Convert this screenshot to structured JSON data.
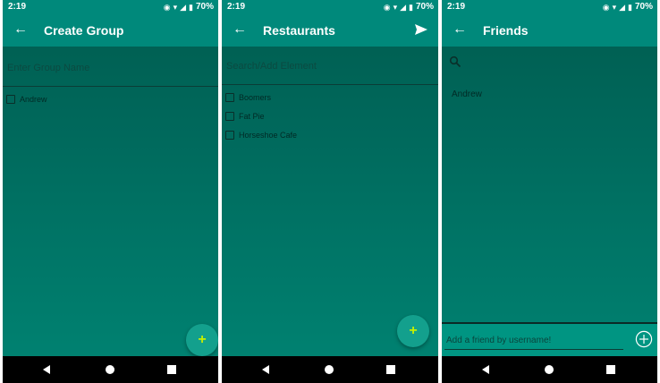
{
  "status_bar": {
    "time": "2:19",
    "battery": "70%"
  },
  "screens": [
    {
      "title": "Create Group",
      "input_placeholder": "Enter Group Name",
      "items": [
        {
          "label": "Andrew"
        }
      ],
      "fab_symbol": "+"
    },
    {
      "title": "Restaurants",
      "input_placeholder": "Search/Add Element",
      "items": [
        {
          "label": "Boomers"
        },
        {
          "label": "Fat Pie"
        },
        {
          "label": "Horseshoe Cafe"
        }
      ],
      "fab_symbol": "+"
    },
    {
      "title": "Friends",
      "friends": [
        {
          "name": "Andrew"
        }
      ],
      "add_friend_placeholder": "Add a friend by username!"
    }
  ],
  "colors": {
    "primary": "#00897b",
    "accent_fab_symbol": "#c6f000"
  },
  "icons": [
    "back-arrow-icon",
    "send-icon",
    "search-icon",
    "add-circle-icon",
    "nav-back-icon",
    "nav-home-icon",
    "nav-recent-icon"
  ]
}
